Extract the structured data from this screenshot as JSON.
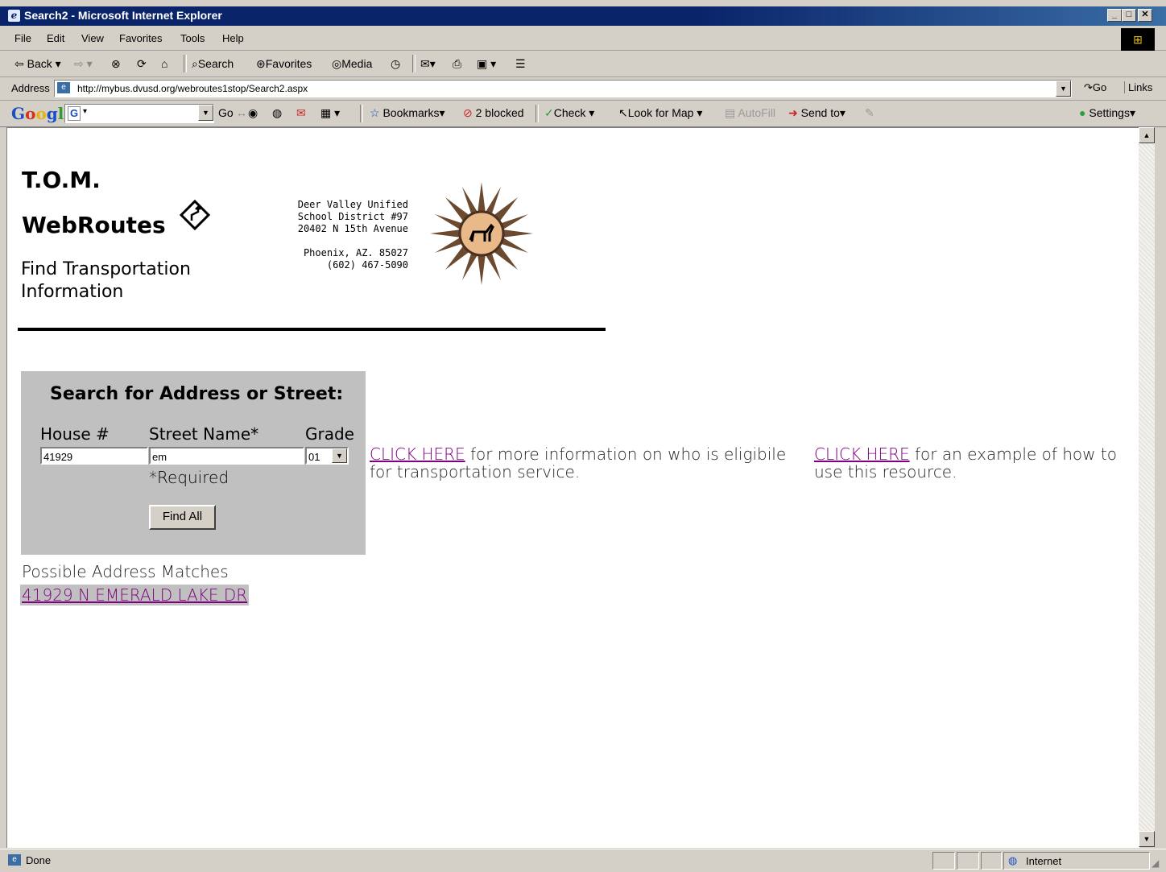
{
  "window": {
    "title": "Search2 - Microsoft Internet Explorer"
  },
  "menu": [
    "File",
    "Edit",
    "View",
    "Favorites",
    "Tools",
    "Help"
  ],
  "toolbar": {
    "back": "Back",
    "search": "Search",
    "favorites": "Favorites",
    "media": "Media"
  },
  "address": {
    "label": "Address",
    "url": "http://mybus.dvusd.org/webroutes1stop/Search2.aspx",
    "go": "Go",
    "links": "Links"
  },
  "google": {
    "logo": "Google",
    "go": "Go",
    "bookmarks": "Bookmarks",
    "blocked": "2 blocked",
    "check": "Check",
    "lookformap": "Look for Map",
    "autofill": "AutoFill",
    "sendto": "Send to",
    "settings": "Settings"
  },
  "page": {
    "brand1": "T.O.M.",
    "brand2": "WebRoutes",
    "subtitle1": "Find Transportation",
    "subtitle2": "Information",
    "district": [
      "Deer Valley Unified",
      "School District #97",
      "20402 N 15th Avenue",
      "Phoenix, AZ. 85027",
      "(602) 467-5090"
    ],
    "search": {
      "title": "Search for Address or Street:",
      "house_label": "House #",
      "street_label": "Street Name*",
      "grade_label": "Grade",
      "house_value": "41929",
      "street_value": "em",
      "grade_value": "01",
      "required": "*Required",
      "find_all": "Find All"
    },
    "info1_link": "CLICK HERE",
    "info1_text": " for more information on who is eligibile for transportation service.",
    "info2_link": "CLICK HERE",
    "info2_text": " for an example of how to use this resource.",
    "matches_label": "Possible Address Matches",
    "matches": [
      "41929 N EMERALD LAKE DR"
    ]
  },
  "status": {
    "text": "Done",
    "zone": "Internet"
  }
}
